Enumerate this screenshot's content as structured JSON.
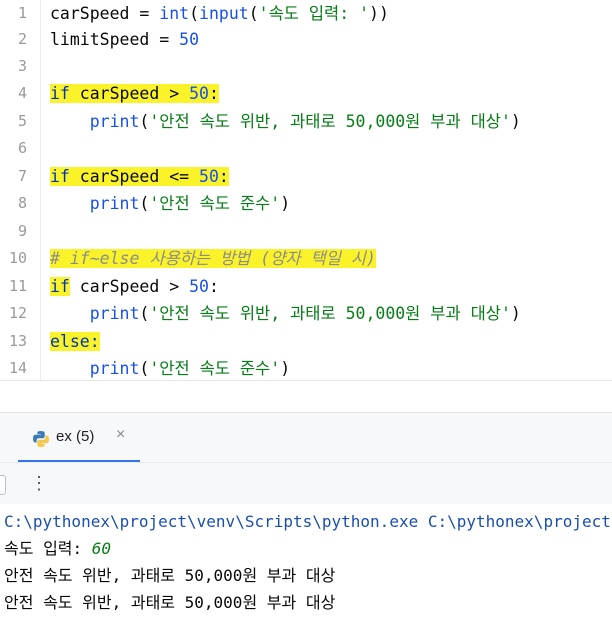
{
  "editor": {
    "lines": [
      {
        "n": "1",
        "text": "carSpeed = int(input('속도 입력: '))"
      },
      {
        "n": "2",
        "text": "limitSpeed = 50"
      },
      {
        "n": "3",
        "text": ""
      },
      {
        "n": "4",
        "text": "if carSpeed > 50:"
      },
      {
        "n": "5",
        "text": "    print('안전 속도 위반, 과태로 50,000원 부과 대상')"
      },
      {
        "n": "6",
        "text": ""
      },
      {
        "n": "7",
        "text": "if carSpeed <= 50:"
      },
      {
        "n": "8",
        "text": "    print('안전 속도 준수')"
      },
      {
        "n": "9",
        "text": ""
      },
      {
        "n": "10",
        "text": "# if~else 사용하는 방법 (양자 택일 시)"
      },
      {
        "n": "11",
        "text": "if carSpeed > 50:"
      },
      {
        "n": "12",
        "text": "    print('안전 속도 위반, 과태로 50,000원 부과 대상')"
      },
      {
        "n": "13",
        "text": "else:"
      },
      {
        "n": "14",
        "text": "    print('안전 속도 준수')"
      }
    ],
    "tokens": {
      "l1_a": "carSpeed = ",
      "l1_fn1": "int",
      "l1_b": "(",
      "l1_fn2": "input",
      "l1_c": "(",
      "l1_str": "'속도 입력: '",
      "l1_d": "))",
      "l2_a": "limitSpeed = ",
      "l2_num": "50",
      "l4_kw": "if",
      "l4_a": " carSpeed > ",
      "l4_num": "50",
      "l4_b": ":",
      "l5_ind": "    ",
      "l5_fn": "print",
      "l5_a": "(",
      "l5_str": "'안전 속도 위반, 과태로 50,000원 부과 대상'",
      "l5_b": ")",
      "l7_kw": "if",
      "l7_a": " carSpeed <= ",
      "l7_num": "50",
      "l7_b": ":",
      "l8_ind": "    ",
      "l8_fn": "print",
      "l8_a": "(",
      "l8_str": "'안전 속도 준수'",
      "l8_b": ")",
      "l10_cmt": "# if~else 사용하는 방법 (양자 택일 시)",
      "l11_kw": "if",
      "l11_a": " carSpeed > ",
      "l11_num": "50",
      "l11_b": ":",
      "l12_ind": "    ",
      "l12_fn": "print",
      "l12_a": "(",
      "l12_str": "'안전 속도 위반, 과태로 50,000원 부과 대상'",
      "l12_b": ")",
      "l13_kw": "else:",
      "l14_ind": "    ",
      "l14_fn": "print",
      "l14_a": "(",
      "l14_str": "'안전 속도 준수'",
      "l14_b": ")"
    },
    "highlight_color": "#fbf32a"
  },
  "run_panel": {
    "tab_label": "ex (5)",
    "tab_close": "×",
    "tab_icon": "python-icon",
    "kebab": "⋮"
  },
  "console": {
    "command": "C:\\pythonex\\project\\venv\\Scripts\\python.exe C:\\pythonex\\project",
    "prompt": "속도 입력: ",
    "input_value": "60",
    "output1": "안전 속도 위반, 과태로 50,000원 부과 대상",
    "output2": "안전 속도 위반, 과태로 50,000원 부과 대상"
  }
}
